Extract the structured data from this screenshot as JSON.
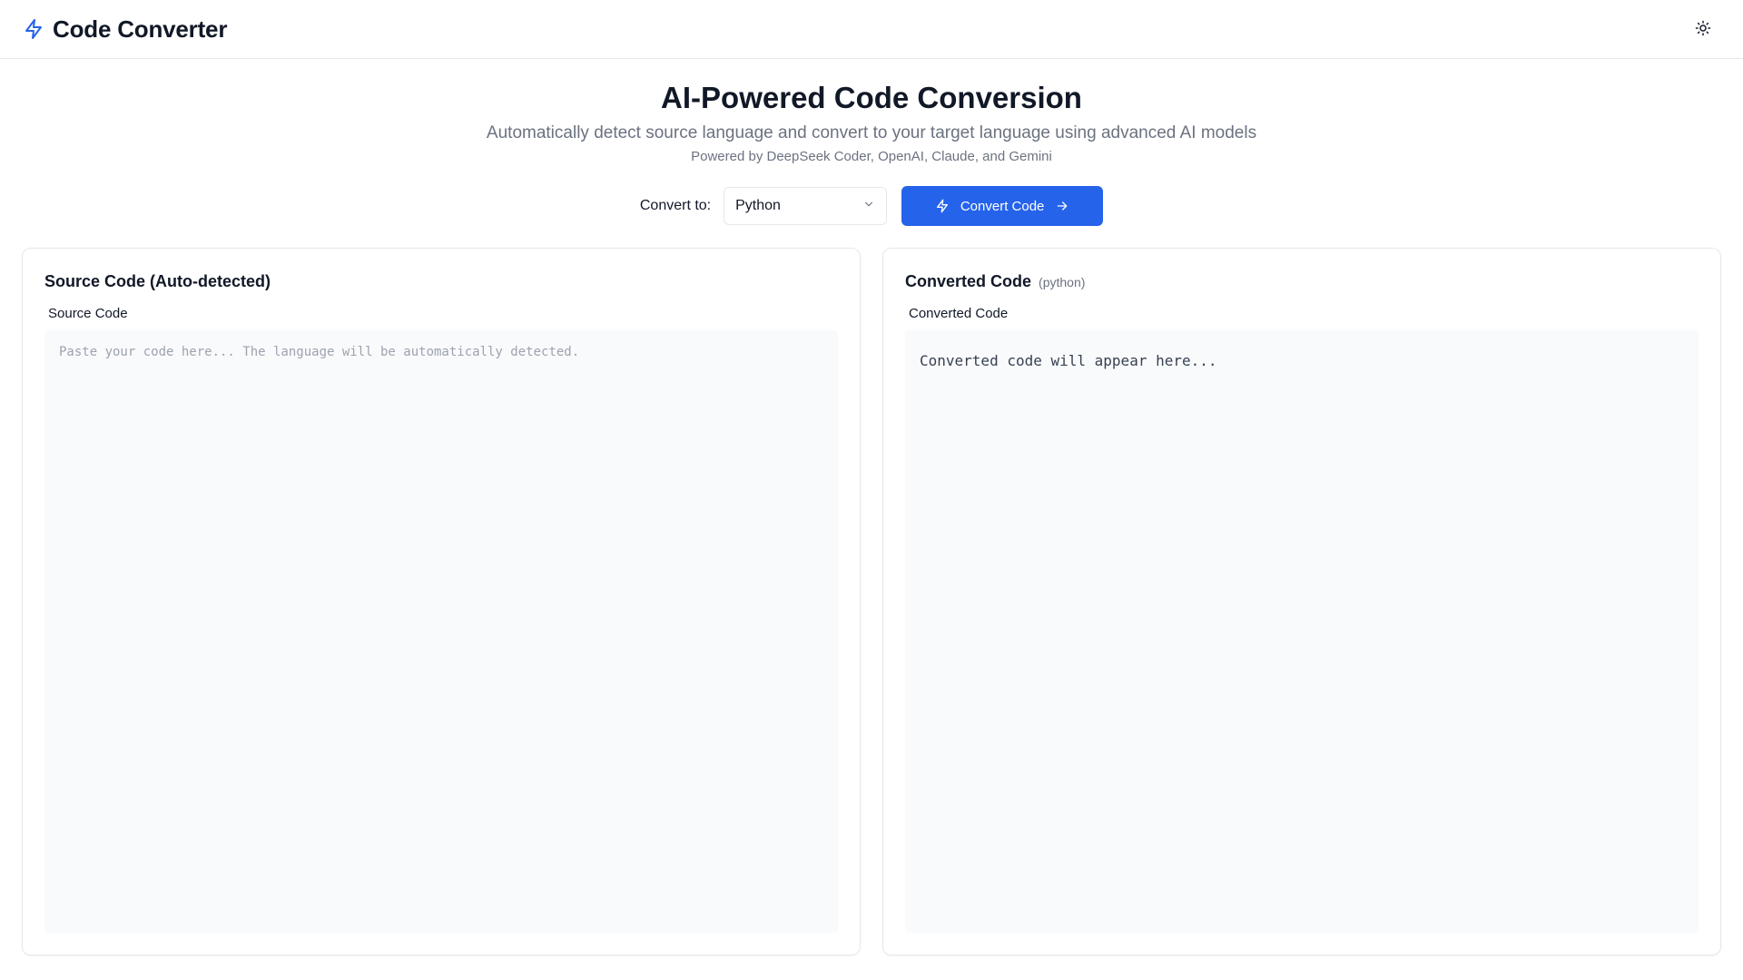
{
  "header": {
    "brand_title": "Code Converter",
    "brand_icon": "lightning-icon",
    "theme_icon": "sun-icon"
  },
  "hero": {
    "title": "AI-Powered Code Conversion",
    "subtitle": "Automatically detect source language and convert to your target language using advanced AI models",
    "powered_by": "Powered by DeepSeek Coder, OpenAI, Claude, and Gemini"
  },
  "controls": {
    "convert_to_label": "Convert to:",
    "selected_language": "Python",
    "convert_button_label": "Convert Code"
  },
  "source_panel": {
    "title": "Source Code (Auto-detected)",
    "field_label": "Source Code",
    "placeholder": "Paste your code here... The language will be automatically detected."
  },
  "output_panel": {
    "title": "Converted Code",
    "language_tag": "(python)",
    "field_label": "Converted Code",
    "placeholder_text": "Converted code will appear here..."
  },
  "colors": {
    "accent": "#2563eb",
    "border": "#e5e7eb",
    "muted_text": "#6b7280",
    "code_bg": "#f9fafb"
  }
}
